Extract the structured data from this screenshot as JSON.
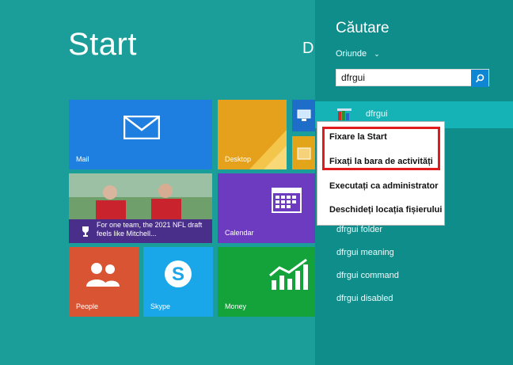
{
  "start": {
    "title": "Start",
    "user_letter": "D",
    "tiles": {
      "mail": "Mail",
      "desktop": "Desktop",
      "news": "For one team, the 2021 NFL draft feels like Mitchell...",
      "calendar": "Calendar",
      "people": "People",
      "skype": "Skype",
      "money": "Money"
    }
  },
  "search": {
    "title": "Căutare",
    "scope": "Oriunde",
    "query": "dfrgui",
    "result": "dfrgui",
    "suggestions": [
      "dfrgui folder",
      "dfrgui meaning",
      "dfrgui command",
      "dfrgui disabled"
    ]
  },
  "context_menu": {
    "items": [
      "Fixare la Start",
      "Fixați la bara de activități",
      "Executați ca administrator",
      "Deschideți locația fișierului"
    ]
  },
  "colors": {
    "background": "#1b9e9a",
    "search_pane": "#0f8d8a",
    "highlight": "#e11b1b",
    "mail_tile": "#1f7fe0",
    "desktop_tile": "#e5a11b",
    "calendar_tile": "#6c3bbf",
    "people_tile": "#d95433",
    "skype_tile": "#1aa7ea",
    "money_tile": "#13a33a"
  }
}
